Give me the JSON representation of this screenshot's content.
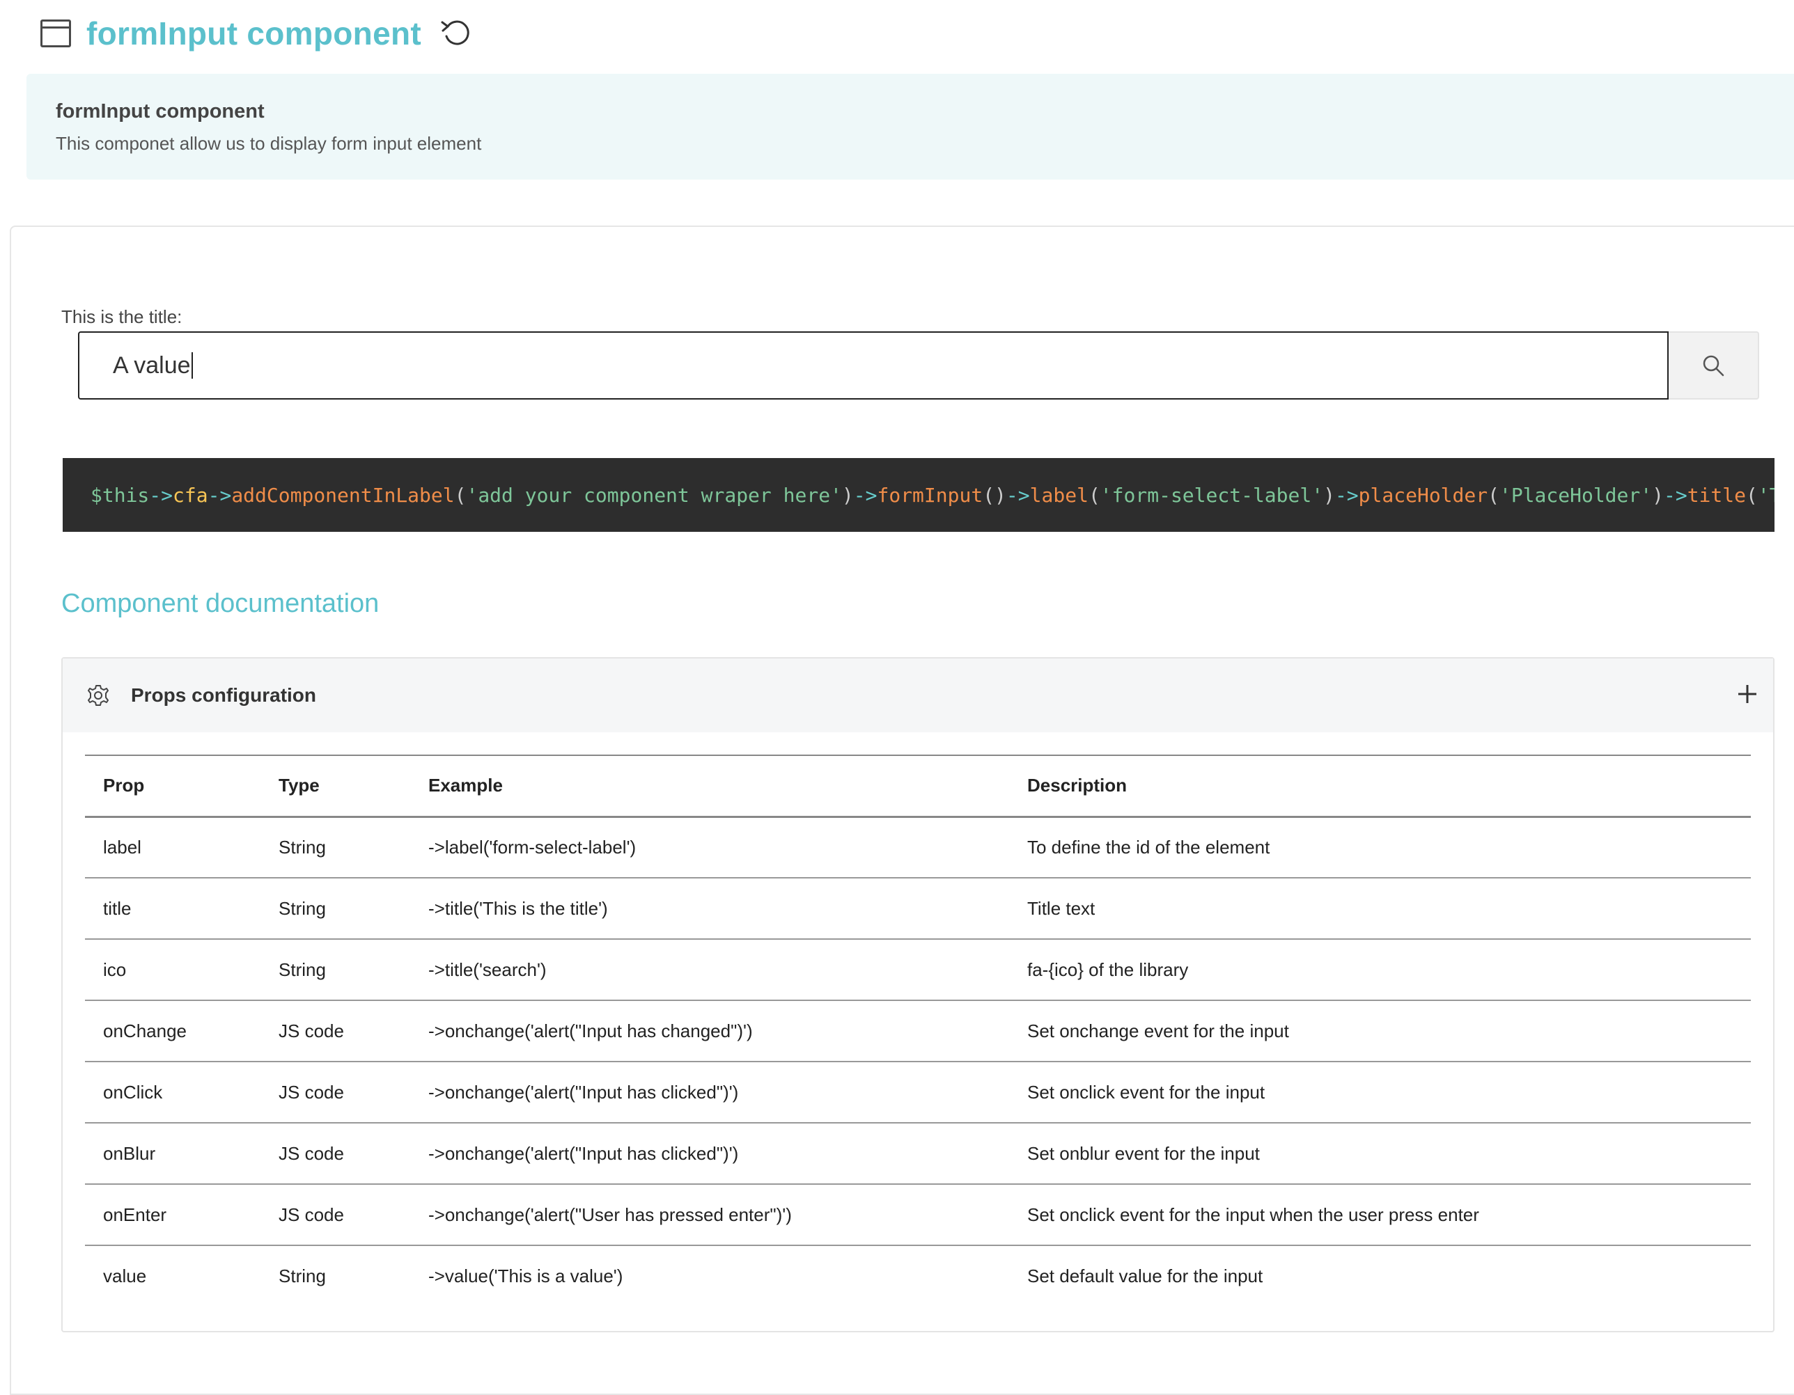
{
  "header": {
    "title": "formInput component",
    "icon": "window-icon",
    "reload_icon": "reload-icon"
  },
  "info": {
    "title": "formInput component",
    "description": "This componet allow us to display form input element"
  },
  "form": {
    "label": "This is the title:",
    "value": "A value",
    "button_icon": "search-icon"
  },
  "code": [
    {
      "cls": "c-var",
      "t": "$this"
    },
    {
      "cls": "c-op",
      "t": "->"
    },
    {
      "cls": "c-prop",
      "t": "cfa"
    },
    {
      "cls": "c-op",
      "t": "->"
    },
    {
      "cls": "c-fn",
      "t": "addComponentInLabel"
    },
    {
      "cls": "c-pun",
      "t": "("
    },
    {
      "cls": "c-str",
      "t": "'add your component wraper here'"
    },
    {
      "cls": "c-pun",
      "t": ")"
    },
    {
      "cls": "c-op",
      "t": "->"
    },
    {
      "cls": "c-fn",
      "t": "formInput"
    },
    {
      "cls": "c-pun",
      "t": "()"
    },
    {
      "cls": "c-op",
      "t": "->"
    },
    {
      "cls": "c-fn",
      "t": "label"
    },
    {
      "cls": "c-pun",
      "t": "("
    },
    {
      "cls": "c-str",
      "t": "'form-select-label'"
    },
    {
      "cls": "c-pun",
      "t": ")"
    },
    {
      "cls": "c-op",
      "t": "->"
    },
    {
      "cls": "c-fn",
      "t": "placeHolder"
    },
    {
      "cls": "c-pun",
      "t": "("
    },
    {
      "cls": "c-str",
      "t": "'PlaceHolder'"
    },
    {
      "cls": "c-pun",
      "t": ")"
    },
    {
      "cls": "c-op",
      "t": "->"
    },
    {
      "cls": "c-fn",
      "t": "title"
    },
    {
      "cls": "c-pun",
      "t": "("
    },
    {
      "cls": "c-str",
      "t": "'This is th"
    }
  ],
  "documentation": {
    "title": "Component documentation",
    "accordion_title": "Props configuration",
    "accordion_icon": "gear-icon",
    "expand_icon": "plus-icon",
    "columns": [
      "Prop",
      "Type",
      "Example",
      "Description"
    ],
    "rows": [
      [
        "label",
        "String",
        "->label('form-select-label')",
        "To define the id of the element"
      ],
      [
        "title",
        "String",
        "->title('This is the title')",
        "Title text"
      ],
      [
        "ico",
        "String",
        "->title('search')",
        "fa-{ico} of the library"
      ],
      [
        "onChange",
        "JS code",
        "->onchange('alert(\"Input has changed\")')",
        "Set onchange event for the input"
      ],
      [
        "onClick",
        "JS code",
        "->onchange('alert(\"Input has clicked\")')",
        "Set onclick event for the input"
      ],
      [
        "onBlur",
        "JS code",
        "->onchange('alert(\"Input has clicked\")')",
        "Set onblur event for the input"
      ],
      [
        "onEnter",
        "JS code",
        "->onchange('alert(\"User has pressed enter\")')",
        "Set onclick event for the input when the user press enter"
      ],
      [
        "value",
        "String",
        "->value('This is a value')",
        "Set default value for the input"
      ]
    ]
  },
  "colors": {
    "accent": "#5bc0cc",
    "info_bg": "#eef8f9",
    "code_bg": "#2d2d2d"
  }
}
